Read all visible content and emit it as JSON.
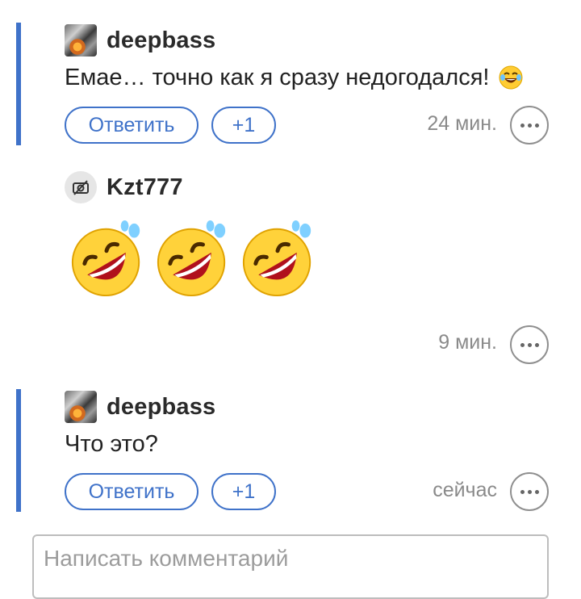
{
  "comments": [
    {
      "author": "deepbass",
      "text": "Емае… точно как я сразу недогодался!",
      "emoji_icon": "laughing-tears-emoji",
      "reply_label": "Ответить",
      "plus_label": "+1",
      "time": "24 мин."
    },
    {
      "author": "Kzt777",
      "emoji_icons": [
        "rolling-laughing-emoji",
        "rolling-laughing-emoji",
        "rolling-laughing-emoji"
      ],
      "time": "9 мин."
    },
    {
      "author": "deepbass",
      "text": "Что это?",
      "reply_label": "Ответить",
      "plus_label": "+1",
      "time": "сейчас"
    }
  ],
  "composer": {
    "placeholder": "Написать комментарий"
  },
  "colors": {
    "accent": "#3f72c9",
    "muted_text": "#8a8a8a"
  }
}
